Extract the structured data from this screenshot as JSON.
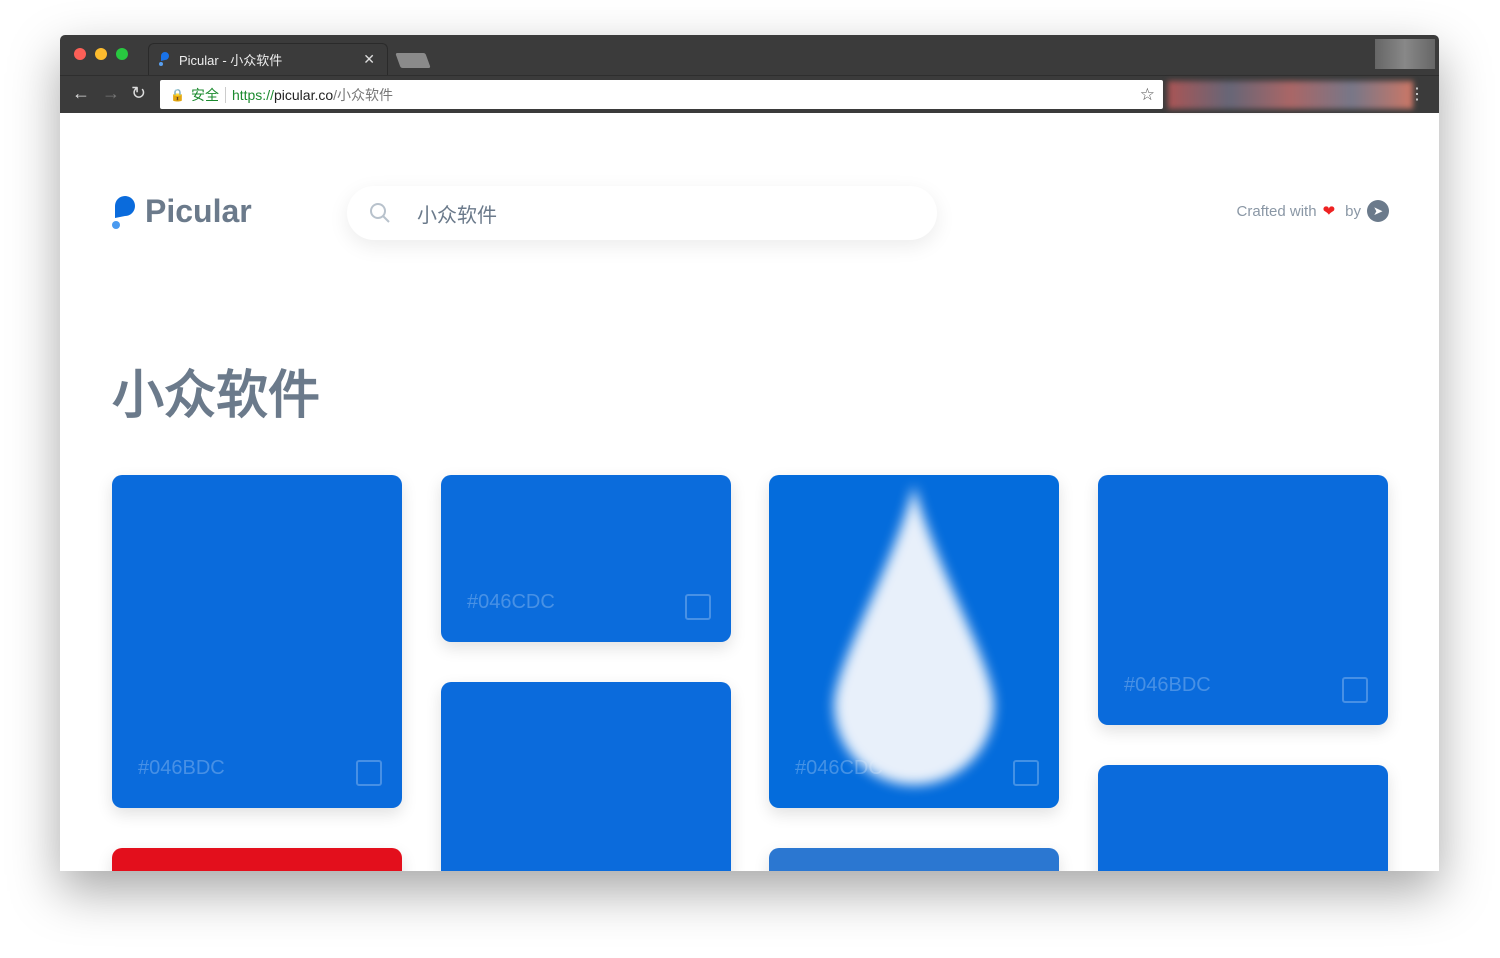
{
  "browser": {
    "tab_title": "Picular - 小众软件",
    "secure_label": "安全",
    "url_scheme": "https://",
    "url_host": "picular.co",
    "url_path": "/小众软件"
  },
  "header": {
    "logo_text": "Picular",
    "search_value": "小众软件",
    "crafted_text": "Crafted with",
    "by_text": "by"
  },
  "main": {
    "title": "小众软件",
    "cards": [
      {
        "hex": "#046BDC",
        "color": "#0a6bdc"
      },
      {
        "hex": "",
        "color": "#e30f1c"
      },
      {
        "hex": "#046CDC",
        "color": "#0b6cdc"
      },
      {
        "hex": "",
        "color": "#0b6bdc"
      },
      {
        "hex": "#046CDC",
        "color": "#046cdc"
      },
      {
        "hex": "",
        "color": "#2b77d1"
      },
      {
        "hex": "#046BDC",
        "color": "#0a6bdc"
      },
      {
        "hex": "",
        "color": "#0b6bdc"
      }
    ]
  },
  "colors": {
    "accent": "#046BDC",
    "text": "#6b7a8b"
  }
}
